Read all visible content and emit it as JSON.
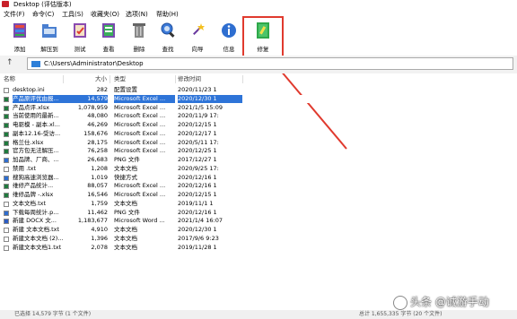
{
  "window": {
    "title": "Desktop (评估版本)"
  },
  "menu": [
    "文件(F)",
    "命令(C)",
    "工具(S)",
    "收藏夹(O)",
    "选项(N)",
    "帮助(H)"
  ],
  "toolbar": [
    {
      "label": "添加",
      "icon": "add-icon"
    },
    {
      "label": "解压到",
      "icon": "extract-icon"
    },
    {
      "label": "测试",
      "icon": "test-icon"
    },
    {
      "label": "查看",
      "icon": "view-icon"
    },
    {
      "label": "删除",
      "icon": "delete-icon"
    },
    {
      "label": "查找",
      "icon": "find-icon"
    },
    {
      "label": "向导",
      "icon": "wizard-icon"
    },
    {
      "label": "信息",
      "icon": "info-icon"
    },
    {
      "label": "修复",
      "icon": "repair-icon"
    }
  ],
  "address": {
    "path": "C:\\Users\\Administrator\\Desktop"
  },
  "columns": {
    "name": "名称",
    "size": "大小",
    "type": "类型",
    "modified": "修改时间"
  },
  "files": [
    {
      "name": "desktop.ini",
      "size": "282",
      "type": "配置设置",
      "date": "2020/11/23 1",
      "icon": "ini"
    },
    {
      "name": "产品原评优由报...",
      "size": "14,579",
      "type": "Microsoft Excel ...",
      "date": "2020/12/30 1",
      "icon": "xls",
      "selected": true
    },
    {
      "name": "产品点评.xlsx",
      "size": "1,078,959",
      "type": "Microsoft Excel ...",
      "date": "2021/1/5 15:09",
      "icon": "xls"
    },
    {
      "name": "当前使用的最新...",
      "size": "48,080",
      "type": "Microsoft Excel ...",
      "date": "2020/11/9 17:",
      "icon": "xls"
    },
    {
      "name": "电驱模 - 副本.xl...",
      "size": "46,269",
      "type": "Microsoft Excel ...",
      "date": "2020/12/15 1",
      "icon": "xls"
    },
    {
      "name": "副本12.16-受访...",
      "size": "158,676",
      "type": "Microsoft Excel ...",
      "date": "2020/12/17 1",
      "icon": "xls"
    },
    {
      "name": "格兰仕.xlsx",
      "size": "28,175",
      "type": "Microsoft Excel ...",
      "date": "2020/5/11 17:",
      "icon": "xls"
    },
    {
      "name": "官方包无法解压...",
      "size": "76,258",
      "type": "Microsoft Excel ...",
      "date": "2020/12/25 1",
      "icon": "xls"
    },
    {
      "name": "加品牌、厂商、...",
      "size": "26,683",
      "type": "PNG 文件",
      "date": "2017/12/27 1",
      "icon": "png"
    },
    {
      "name": "禁用 .txt",
      "size": "1,208",
      "type": "文本文档",
      "date": "2020/9/25 17:",
      "icon": "txt"
    },
    {
      "name": "搜狗高速浏览器...",
      "size": "1,019",
      "type": "快捷方式",
      "date": "2020/12/16 1",
      "icon": "lnk"
    },
    {
      "name": "维修产品统计...",
      "size": "88,057",
      "type": "Microsoft Excel ...",
      "date": "2020/12/16 1",
      "icon": "xls"
    },
    {
      "name": "维修品牌 -.xlsx",
      "size": "16,546",
      "type": "Microsoft Excel ...",
      "date": "2020/12/15 1",
      "icon": "xls"
    },
    {
      "name": "文本文档.txt",
      "size": "1,759",
      "type": "文本文档",
      "date": "2019/11/1 1",
      "icon": "txt"
    },
    {
      "name": "下载每周统计.p...",
      "size": "11,462",
      "type": "PNG 文件",
      "date": "2020/12/16 1",
      "icon": "png"
    },
    {
      "name": "新建 DOCX 文...",
      "size": "1,183,677",
      "type": "Microsoft Word ...",
      "date": "2021/1/4 16:07",
      "icon": "doc"
    },
    {
      "name": "新建 文本文档.txt",
      "size": "4,910",
      "type": "文本文档",
      "date": "2020/12/30 1",
      "icon": "txt"
    },
    {
      "name": "新建文本文档 (2)...",
      "size": "1,396",
      "type": "文本文档",
      "date": "2017/9/6 9:23",
      "icon": "txt"
    },
    {
      "name": "新建文本文档1.txt",
      "size": "2,078",
      "type": "文本文档",
      "date": "2019/11/28 1",
      "icon": "txt"
    }
  ],
  "status": {
    "left": "已选择 14,579 字节 (1 个文件)",
    "right": "总计 1,655,335 字节 (20 个文件)"
  },
  "watermark": "头条 @诚游手动",
  "colors": {
    "selection": "#2e74d8",
    "highlight_box": "#e03a2e"
  }
}
